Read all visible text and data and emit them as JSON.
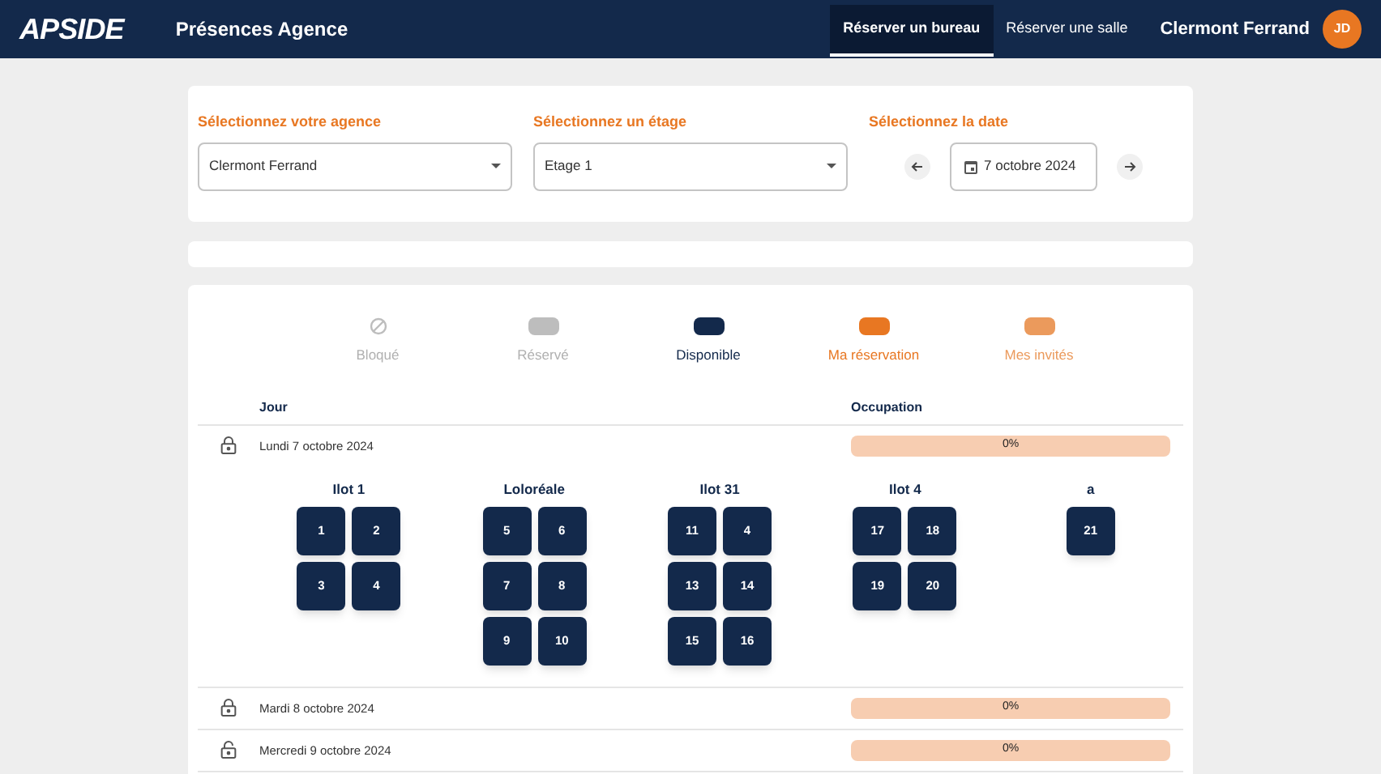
{
  "header": {
    "logo": "APSIDE",
    "title": "Présences Agence",
    "tabs": [
      {
        "label": "Réserver un bureau",
        "selected": true
      },
      {
        "label": "Réserver une salle",
        "selected": false
      }
    ],
    "user_location": "Clermont Ferrand",
    "avatar": "JD"
  },
  "filters": [
    {
      "label": "Sélectionnez votre agence",
      "value": "Clermont Ferrand",
      "kind": "select"
    },
    {
      "label": "Sélectionnez un étage",
      "value": "Etage 1",
      "kind": "select"
    },
    {
      "label": "Sélectionnez la date",
      "value": "7 octobre 2024",
      "kind": "date"
    }
  ],
  "legend": [
    {
      "label": "Bloqué",
      "kind": "icon",
      "color": "#bdbdbd"
    },
    {
      "label": "Réservé",
      "kind": "swatch",
      "color": "#bdbdbd"
    },
    {
      "label": "Disponible",
      "kind": "swatch",
      "color": "#13294b"
    },
    {
      "label": "Ma réservation",
      "kind": "swatch",
      "color": "#e87722"
    },
    {
      "label": "Mes invités",
      "kind": "swatch",
      "color": "#eb9a5c"
    }
  ],
  "table": {
    "columns": [
      "Jour",
      "Occupation"
    ],
    "rows": [
      {
        "day": "Lundi 7 octobre 2024",
        "locked": true,
        "occupation": "0%",
        "islands": [
          {
            "name": "Ilot 1",
            "desks": [
              "1",
              "2",
              "3",
              "4"
            ]
          },
          {
            "name": "Loloréale",
            "desks": [
              "5",
              "6",
              "7",
              "8",
              "9",
              "10"
            ]
          },
          {
            "name": "Ilot 31",
            "desks": [
              "11",
              "4",
              "13",
              "14",
              "15",
              "16"
            ]
          },
          {
            "name": "Ilot 4",
            "desks": [
              "17",
              "18",
              "19",
              "20"
            ]
          },
          {
            "name": "a",
            "desks": [
              "21"
            ]
          }
        ]
      },
      {
        "day": "Mardi 8 octobre 2024",
        "locked": true,
        "occupation": "0%"
      },
      {
        "day": "Mercredi 9 octobre 2024",
        "locked": false,
        "occupation": "0%"
      }
    ]
  }
}
